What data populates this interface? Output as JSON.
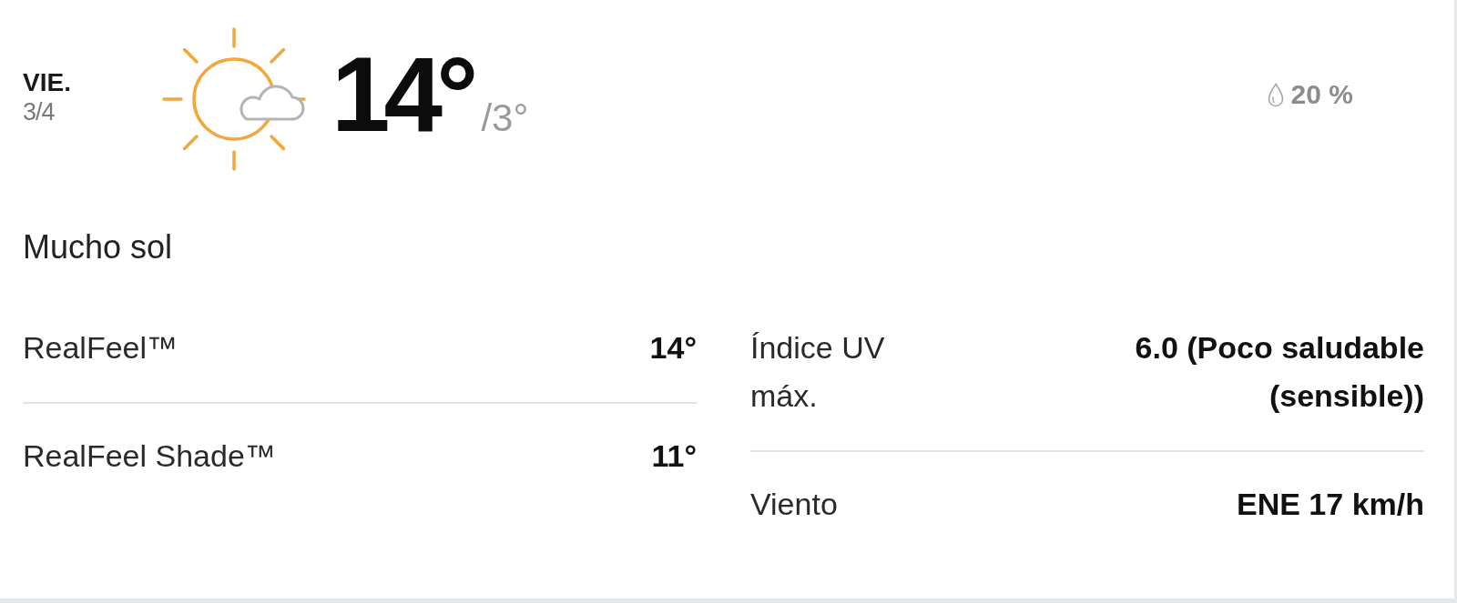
{
  "day": {
    "weekday": "VIE.",
    "date": "3/4"
  },
  "temperature": {
    "high": "14°",
    "low": "/3°"
  },
  "precipitation": "20 %",
  "phrase": "Mucho sol",
  "details_left": [
    {
      "label": "RealFeel™",
      "value": "14°"
    },
    {
      "label": "RealFeel Shade™",
      "value": "11°"
    }
  ],
  "details_right": [
    {
      "label": "Índice UV máx.",
      "value": "6.0 (Poco saludable (sensible))"
    },
    {
      "label": "Viento",
      "value": "ENE 17 km/h"
    }
  ]
}
